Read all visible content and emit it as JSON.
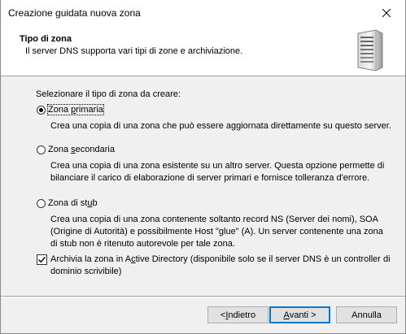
{
  "window": {
    "title": "Creazione guidata nuova zona"
  },
  "header": {
    "title": "Tipo di zona",
    "subtitle": "Il server DNS supporta vari tipi di zone e archiviazione."
  },
  "prompt": "Selezionare il tipo di zona da creare:",
  "options": [
    {
      "label_pre": "Zona ",
      "label_key": "p",
      "label_post": "rimaria",
      "selected": true,
      "description": "Crea una copia di una zona che può essere aggiornata direttamente su questo server."
    },
    {
      "label_pre": "Zona ",
      "label_key": "s",
      "label_post": "econdaria",
      "selected": false,
      "description": "Crea una copia di una zona esistente su un altro server. Questa opzione permette di bilanciare il carico di elaborazione di server primari e fornisce tolleranza d'errore."
    },
    {
      "label_pre": "Zona di st",
      "label_key": "u",
      "label_post": "b",
      "selected": false,
      "description": "Crea una copia di una zona contenente soltanto record NS (Server dei nomi), SOA (Origine di Autorità) e possibilmente Host \"glue\" (A). Un server contenente una zona di stub non è ritenuto autorevole per tale zona."
    }
  ],
  "ad_checkbox": {
    "checked": true,
    "label_pre": "Archivia la zona in A",
    "label_key": "c",
    "label_post": "tive Directory (disponibile solo se il server DNS è un controller di dominio scrivibile)"
  },
  "buttons": {
    "back": {
      "pre": "< ",
      "key": "I",
      "post": "ndietro"
    },
    "next": {
      "pre": "",
      "key": "A",
      "post": "vanti >"
    },
    "cancel": {
      "label": "Annulla"
    }
  },
  "icons": {
    "close": "close-icon",
    "server": "server-icon"
  }
}
